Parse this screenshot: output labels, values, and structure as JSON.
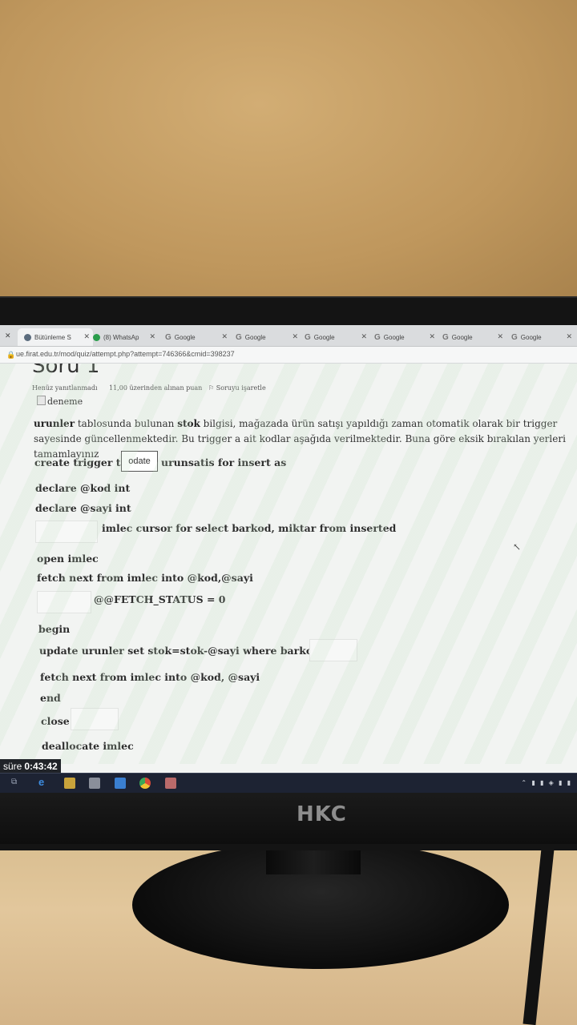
{
  "browser": {
    "tabs": [
      {
        "label": "Bütünleme S",
        "active": true
      },
      {
        "label": "(8) WhatsAp"
      },
      {
        "label": "Google"
      },
      {
        "label": "Google"
      },
      {
        "label": "Google"
      },
      {
        "label": "Google"
      },
      {
        "label": "Google"
      },
      {
        "label": "Google"
      }
    ],
    "url": "ue.firat.edu.tr/mod/quiz/attempt.php?attempt=746366&cmid=398237"
  },
  "question": {
    "title": "Soru 1",
    "status": "Henüz yanıtlanmadı",
    "points": "11,00 üzerinden alınan puan",
    "flag": "Soruyu işaretle",
    "image_alt": "deneme",
    "intro": {
      "bold1": "urunler",
      "text1": " tablosunda bulunan ",
      "bold2": "stok",
      "text2": " bilgisi, mağazada ürün satışı yapıldığı zaman otomatik olarak bir trigger sayesinde güncellenmektedir. Bu trigger a ait kodlar aşağıda verilmektedir. Buna göre eksik bırakılan yerleri tamamlayınız"
    },
    "code": {
      "line1_prefix": "create trigger trg",
      "answer1_value": "odate",
      "line1_suffix": "urunsatis for insert as",
      "line2": "declare @kod int",
      "line3": "declare @sayi int",
      "line4_suffix": "imlec cursor for select barkod, miktar from inserted",
      "line5": "open imlec",
      "line6": "fetch next from imlec into @kod,@sayi",
      "line7_suffix": "@@FETCH_STATUS = 0",
      "line8": "begin",
      "line9": "update urunler set stok=stok-@sayi where barkod=",
      "line10": "fetch next from imlec into @kod, @sayi",
      "line11": "end",
      "line12": "close",
      "line13": "deallocate imlec"
    }
  },
  "timer": {
    "label": "süre",
    "value": "0:43:42"
  },
  "monitor": {
    "brand": "HKC"
  }
}
